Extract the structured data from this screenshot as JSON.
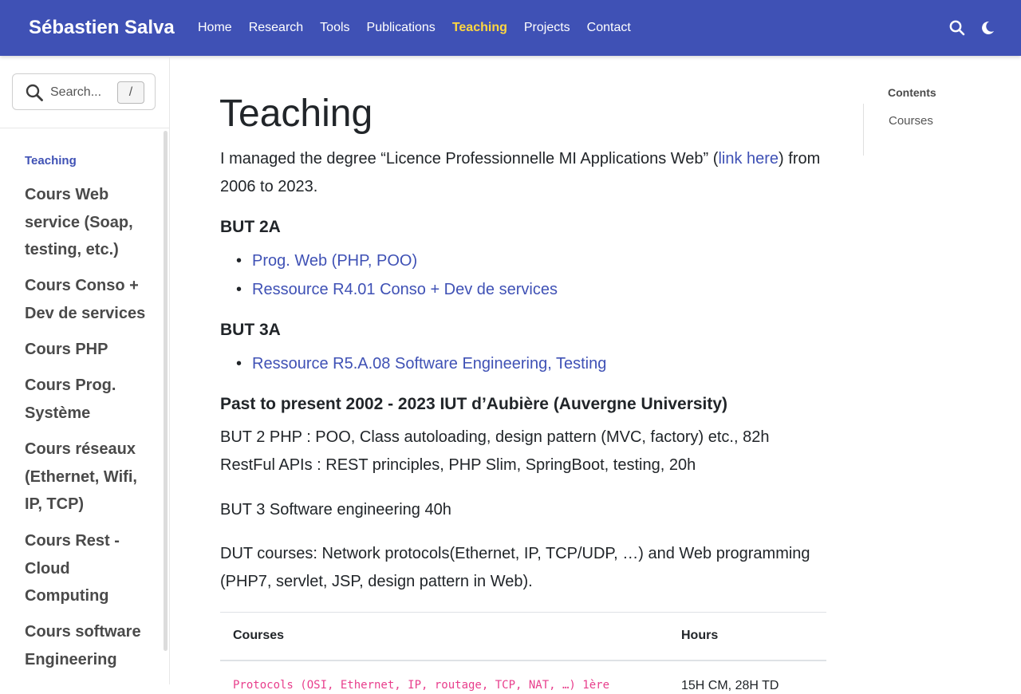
{
  "navbar": {
    "brand": "Sébastien Salva",
    "links": [
      "Home",
      "Research",
      "Tools",
      "Publications",
      "Teaching",
      "Projects",
      "Contact"
    ],
    "active_link": "Teaching",
    "icons": [
      "search-icon",
      "theme-toggle-icon"
    ],
    "colors": {
      "background": "#3f51b5",
      "active": "#ffd740"
    }
  },
  "sidebar": {
    "search": {
      "placeholder": "Search...",
      "shortcut": "/"
    },
    "heading": "Teaching",
    "items": [
      "Cours Web service (Soap, testing, etc.)",
      "Cours Conso + Dev de services",
      "Cours PHP",
      "Cours Prog. Système",
      "Cours réseaux (Ethernet, Wifi, IP, TCP)",
      "Cours Rest - Cloud Computing",
      "Cours software Engineering"
    ]
  },
  "main": {
    "title": "Teaching",
    "intro_before_link": "I managed the degree “Licence Professionnelle MI Applications Web” (",
    "intro_link": "link here",
    "intro_after_link": ") from 2006 to 2023.",
    "sections": [
      {
        "heading": "BUT 2A",
        "links": [
          "Prog. Web (PHP, POO)",
          "Ressource R4.01 Conso + Dev de services"
        ]
      },
      {
        "heading": "BUT 3A",
        "links": [
          "Ressource R5.A.08 Software Engineering, Testing"
        ]
      }
    ],
    "past_heading": "Past to present 2002 - 2023 IUT d’Aubière (Auvergne University)",
    "paragraphs": [
      "BUT 2 PHP : POO, Class autoloading, design pattern (MVC, factory) etc., 82h",
      "RestFul APIs : REST principles, PHP Slim, SpringBoot, testing, 20h",
      "BUT 3 Software engineering 40h",
      "DUT courses: Network protocols(Ethernet, IP, TCP/UDP, …) and Web programming (PHP7, servlet, JSP, design pattern in Web)."
    ],
    "table": {
      "headers": [
        "Courses",
        "Hours"
      ],
      "rows": [
        [
          "Protocols (OSI, Ethernet, IP, routage, TCP, NAT, …) 1ère",
          "15H CM, 28H TD"
        ]
      ]
    }
  },
  "right_toc": {
    "title": "Contents",
    "links": [
      "Courses"
    ]
  }
}
